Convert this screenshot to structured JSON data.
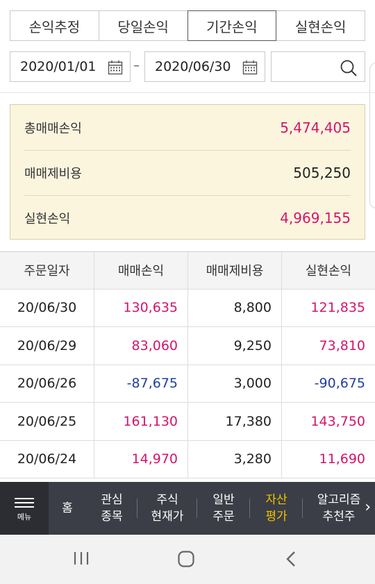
{
  "tabs": [
    {
      "label": "손익추정",
      "active": false
    },
    {
      "label": "당일손익",
      "active": false
    },
    {
      "label": "기간손익",
      "active": true
    },
    {
      "label": "실현손익",
      "active": false
    }
  ],
  "date_range": {
    "start": "2020/01/01",
    "separator": "–",
    "end": "2020/06/30"
  },
  "search": {
    "icon": "search-icon"
  },
  "summary": [
    {
      "label": "총매매손익",
      "value": "5,474,405",
      "color": "#d4146b"
    },
    {
      "label": "매매제비용",
      "value": "505,250",
      "color": "#222222"
    },
    {
      "label": "실현손익",
      "value": "4,969,155",
      "color": "#d4146b"
    }
  ],
  "table": {
    "headers": [
      "주문일자",
      "매매손익",
      "매매제비용",
      "실현손익"
    ],
    "rows": [
      {
        "date": "20/06/30",
        "pnl": "130,635",
        "cost": "8,800",
        "realized": "121,835",
        "sign": "pos"
      },
      {
        "date": "20/06/29",
        "pnl": "83,060",
        "cost": "9,250",
        "realized": "73,810",
        "sign": "pos"
      },
      {
        "date": "20/06/26",
        "pnl": "-87,675",
        "cost": "3,000",
        "realized": "-90,675",
        "sign": "neg"
      },
      {
        "date": "20/06/25",
        "pnl": "161,130",
        "cost": "17,380",
        "realized": "143,750",
        "sign": "pos"
      },
      {
        "date": "20/06/24",
        "pnl": "14,970",
        "cost": "3,280",
        "realized": "11,690",
        "sign": "pos"
      }
    ]
  },
  "menubar": {
    "menu_label": "메뉴",
    "items": [
      {
        "line1": "홈",
        "line2": "",
        "active": false
      },
      {
        "line1": "관심",
        "line2": "종목",
        "active": false
      },
      {
        "line1": "주식",
        "line2": "현재가",
        "active": false
      },
      {
        "line1": "일반",
        "line2": "주문",
        "active": false
      },
      {
        "line1": "자산",
        "line2": "평가",
        "active": true
      },
      {
        "line1": "알고리즘",
        "line2": "추천주",
        "active": false
      }
    ],
    "active_color": "#f2c200"
  },
  "colors": {
    "positive": "#d4146b",
    "negative": "#1d3fa6",
    "summary_bg": "#fbf5de",
    "menubar_bg": "#3b3e46"
  }
}
